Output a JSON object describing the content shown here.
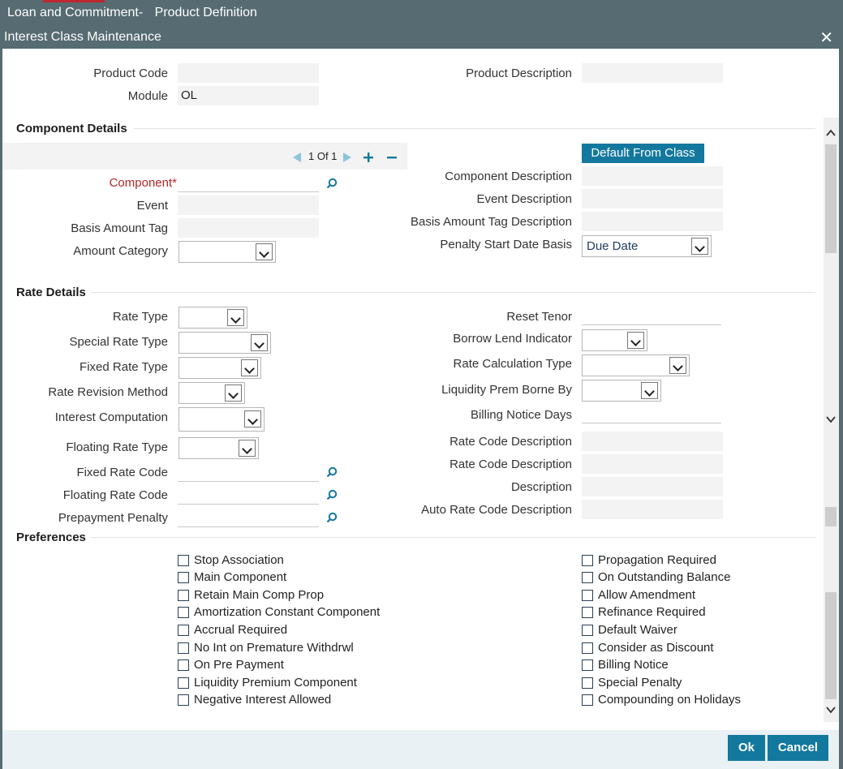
{
  "window": {
    "breadcrumb_left": "Loan and Commitment-",
    "breadcrumb_right": "Product Definition",
    "title": "Interest Class Maintenance",
    "close_glyph": "✕"
  },
  "product": {
    "code_label": "Product Code",
    "code_value": "",
    "module_label": "Module",
    "module_value": "OL",
    "description_label": "Product Description",
    "description_value": ""
  },
  "component_details": {
    "heading": "Component Details",
    "pager": "1 Of 1",
    "default_from_class": "Default From Class",
    "component_label": "Component",
    "required_mark": "*",
    "event_label": "Event",
    "basis_amount_tag_label": "Basis Amount Tag",
    "amount_category_label": "Amount Category",
    "component_description_label": "Component Description",
    "event_description_label": "Event Description",
    "basis_amount_tag_description_label": "Basis Amount Tag Description",
    "penalty_start_date_basis_label": "Penalty Start Date Basis",
    "penalty_start_date_basis_value": "Due Date"
  },
  "rate_details": {
    "heading": "Rate Details",
    "rate_type_label": "Rate Type",
    "special_rate_type_label": "Special Rate Type",
    "fixed_rate_type_label": "Fixed Rate Type",
    "rate_revision_method_label": "Rate Revision Method",
    "interest_computation_label": "Interest Computation",
    "floating_rate_type_label": "Floating Rate Type",
    "fixed_rate_code_label": "Fixed Rate Code",
    "floating_rate_code_label": "Floating Rate Code",
    "prepayment_penalty_label": "Prepayment Penalty",
    "reset_tenor_label": "Reset Tenor",
    "borrow_lend_indicator_label": "Borrow Lend Indicator",
    "rate_calculation_type_label": "Rate Calculation Type",
    "liquidity_prem_borne_by_label": "Liquidity Prem Borne By",
    "billing_notice_days_label": "Billing Notice Days",
    "rate_code_description_1_label": "Rate Code Description",
    "rate_code_description_2_label": "Rate Code Description",
    "description_label": "Description",
    "auto_rate_code_description_label": "Auto Rate Code Description"
  },
  "preferences": {
    "heading": "Preferences",
    "left": [
      "Stop Association",
      "Main Component",
      "Retain Main Comp Prop",
      "Amortization Constant Component",
      "Accrual Required",
      "No Int on Premature Withdrwl",
      "On Pre Payment",
      "Liquidity Premium Component",
      "Negative Interest Allowed"
    ],
    "right": [
      "Propagation Required",
      "On Outstanding Balance",
      "Allow Amendment",
      "Refinance Required",
      "Default Waiver",
      "Consider as Discount",
      "Billing Notice",
      "Special Penalty",
      "Compounding on Holidays"
    ]
  },
  "footer": {
    "ok": "Ok",
    "cancel": "Cancel"
  },
  "colors": {
    "header": "#566b72",
    "accent": "#13789e",
    "required": "#b3262b"
  }
}
